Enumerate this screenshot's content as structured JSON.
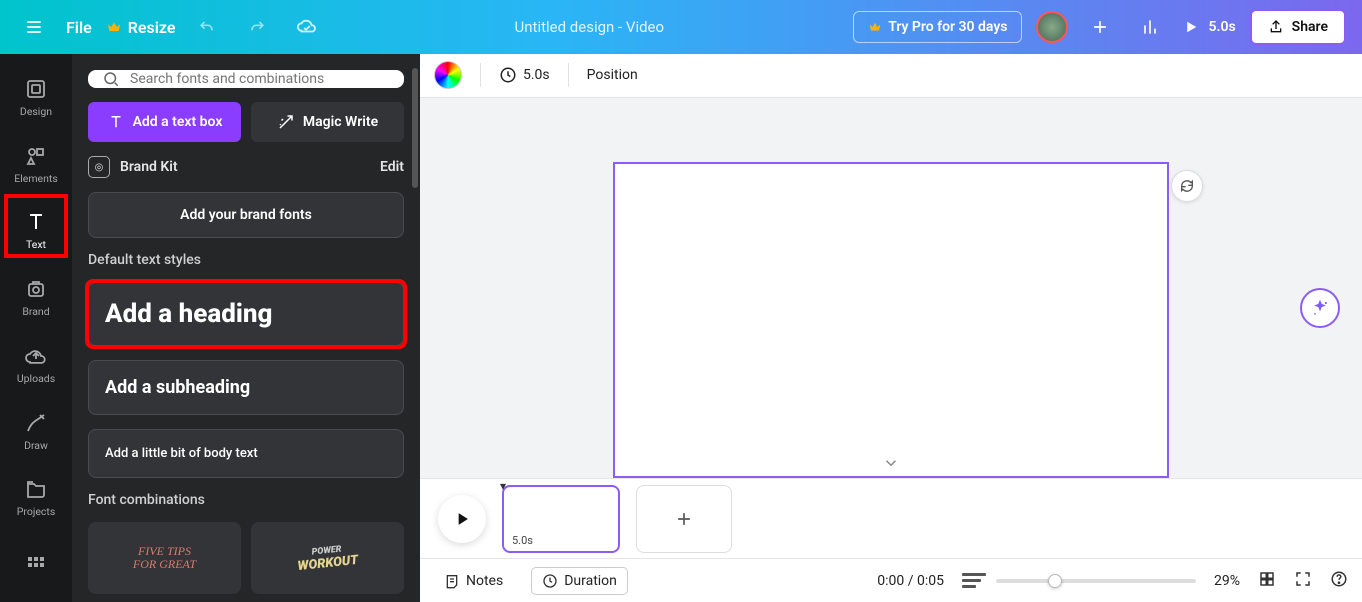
{
  "topbar": {
    "file": "File",
    "resize": "Resize",
    "title": "Untitled design - Video",
    "try_pro": "Try Pro for 30 days",
    "play_duration": "5.0s",
    "share": "Share"
  },
  "rail": {
    "design": "Design",
    "elements": "Elements",
    "text": "Text",
    "brand": "Brand",
    "uploads": "Uploads",
    "draw": "Draw",
    "projects": "Projects"
  },
  "panel": {
    "search_placeholder": "Search fonts and combinations",
    "add_text_box": "Add a text box",
    "magic_write": "Magic Write",
    "brand_kit": "Brand Kit",
    "edit": "Edit",
    "add_brand_fonts": "Add your brand fonts",
    "default_styles": "Default text styles",
    "heading": "Add a heading",
    "subheading": "Add a subheading",
    "body": "Add a little bit of body text",
    "font_combos": "Font combinations",
    "combo_a": "FIVE TIPS\nFOR GREAT",
    "combo_b_small": "POWER",
    "combo_b_big": "WORKOUT"
  },
  "context_bar": {
    "duration": "5.0s",
    "position": "Position"
  },
  "timeline": {
    "clip_duration": "5.0s"
  },
  "bottombar": {
    "notes": "Notes",
    "duration": "Duration",
    "time": "0:00 / 0:05",
    "zoom": "29%"
  }
}
